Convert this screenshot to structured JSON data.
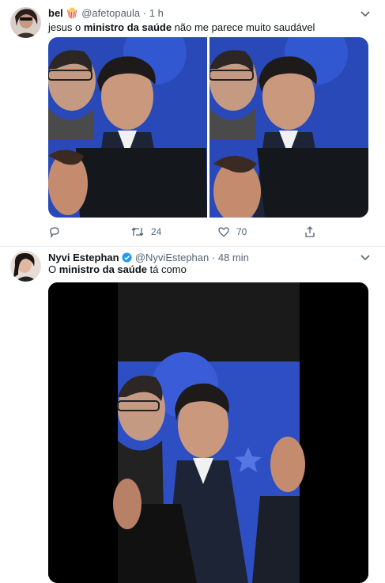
{
  "tweets": [
    {
      "display_name": "bel",
      "name_emoji": "🍿",
      "handle": "@afetopaula",
      "time": "1 h",
      "text_parts": [
        "jesus o ",
        "ministro da saúde",
        " não me parece muito saudável"
      ],
      "counts": {
        "reply": "",
        "retweet": "24",
        "like": "70"
      }
    },
    {
      "display_name": "Nyvi Estephan",
      "handle": "@NyviEstephan",
      "time": "48 min",
      "text_parts": [
        "O ",
        "ministro da saúde",
        " tá como"
      ]
    }
  ],
  "separator": "·",
  "colors": {
    "link_blue": "#1d9bf0",
    "muted": "#536471",
    "divider": "#e6ecf0",
    "verified": "#1d9bf0"
  },
  "icons": [
    "chevron-down-icon",
    "reply-icon",
    "retweet-icon",
    "like-icon",
    "share-icon",
    "verified-badge-icon",
    "popcorn-emoji"
  ]
}
